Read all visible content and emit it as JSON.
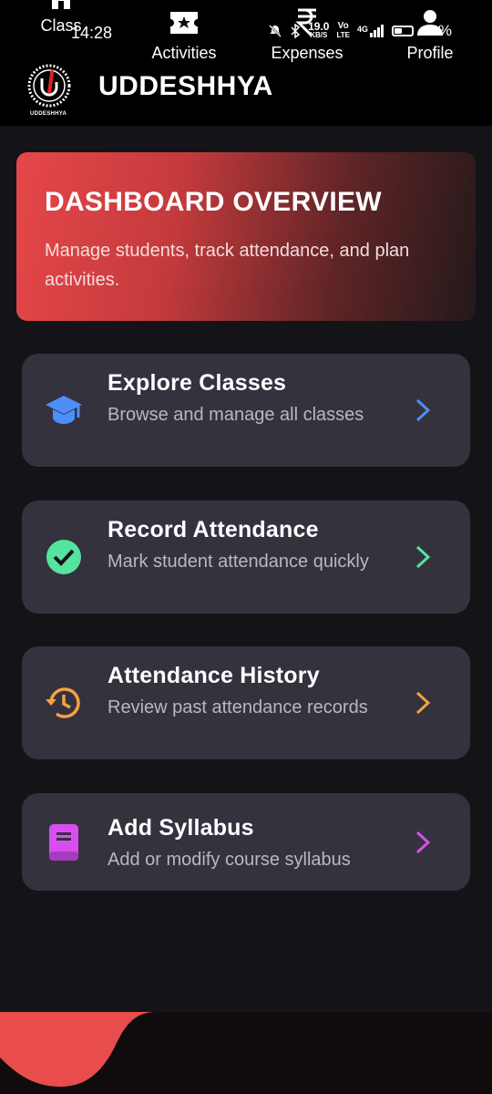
{
  "status": {
    "time": "14:28",
    "speed_top": "19.0",
    "speed_bottom": "KB/S",
    "volte_top": "Vo",
    "volte_bottom": "LTE",
    "network": "4G",
    "battery": "40%"
  },
  "app": {
    "title": "UDDESHHYA",
    "logo_text": "UDDESHHYA",
    "accent": "#e94c4c"
  },
  "hero": {
    "title": "DASHBOARD OVERVIEW",
    "subtitle": "Manage students, track attendance, and plan activities."
  },
  "cards": [
    {
      "title": "Explore Classes",
      "subtitle": "Browse and manage all classes",
      "icon": "graduation-cap-icon",
      "color": "#4f8ef7"
    },
    {
      "title": "Record Attendance",
      "subtitle": "Mark student attendance quickly",
      "icon": "check-circle-icon",
      "color": "#56e39f"
    },
    {
      "title": "Attendance History",
      "subtitle": "Review past attendance records",
      "icon": "history-icon",
      "color": "#f5a043"
    },
    {
      "title": "Add Syllabus",
      "subtitle": "Add or modify course syllabus",
      "icon": "book-icon",
      "color": "#d94ef0"
    }
  ],
  "nav": {
    "items": [
      {
        "label": "Class",
        "icon": "home-icon",
        "active": true
      },
      {
        "label": "Activities",
        "icon": "ticket-star-icon",
        "active": false
      },
      {
        "label": "Expenses",
        "icon": "rupee-icon",
        "active": false
      },
      {
        "label": "Profile",
        "icon": "person-icon",
        "active": false
      }
    ]
  }
}
